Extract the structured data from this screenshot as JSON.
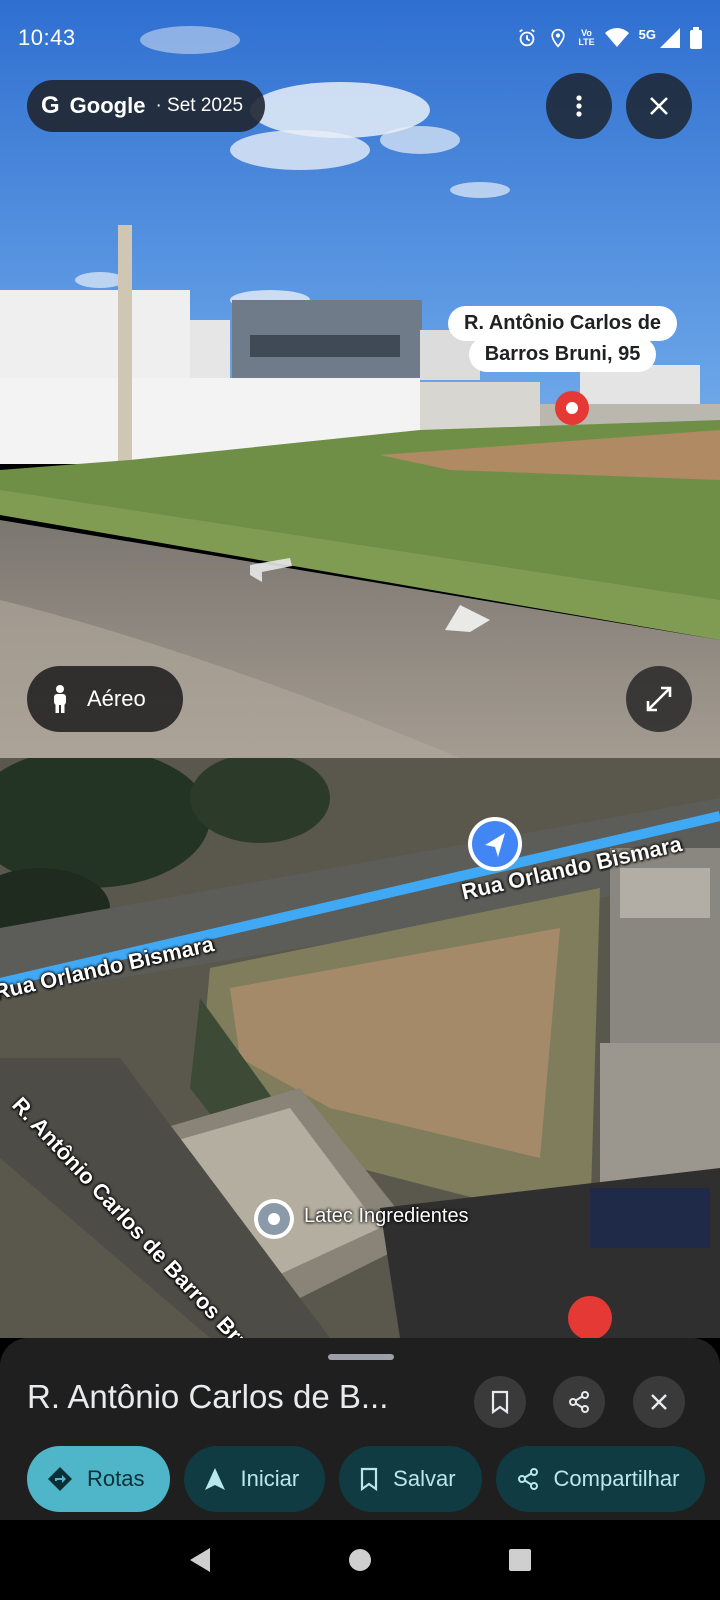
{
  "status_bar": {
    "time": "10:43",
    "network_lte": "Vo) LTE",
    "network_5g": "5G",
    "icons": [
      "alarm-icon",
      "location-icon",
      "volte-icon",
      "wifi-icon",
      "signal-icon",
      "battery-icon"
    ]
  },
  "street_view": {
    "google_label": "Google",
    "date_label": "· Set 2025",
    "address_line1": "R. Antônio Carlos de",
    "address_line2": "Barros Bruni, 95",
    "aereo_label": "Aéreo",
    "menu_icon": "more-vert-icon",
    "close_icon": "close-icon",
    "expand_icon": "expand-icon"
  },
  "map": {
    "street_1": "Rua Orlando Bismara",
    "street_1b": "Rua Orlando Bismara",
    "street_2": "R. Antônio Carlos de Barros Bruni",
    "poi": "Latec Ingredientes"
  },
  "sheet": {
    "title": "R. Antônio Carlos de B...",
    "actions": {
      "rotas": "Rotas",
      "iniciar": "Iniciar",
      "salvar": "Salvar",
      "compartilhar": "Compartilhar"
    }
  },
  "colors": {
    "accent": "#4fb6c9",
    "chip_dark": "#103b42",
    "sheet_bg": "#1f1f1f",
    "route_blue": "#3fa9f5",
    "pin_red": "#e53935"
  }
}
